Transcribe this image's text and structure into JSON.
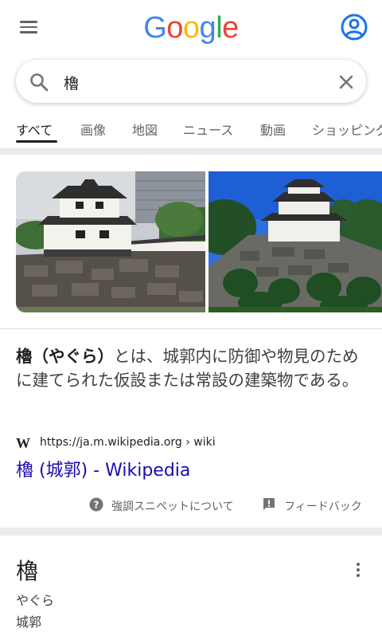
{
  "header": {
    "logo_letters": [
      {
        "ch": "G",
        "color": "#4285F4"
      },
      {
        "ch": "o",
        "color": "#EA4335"
      },
      {
        "ch": "o",
        "color": "#FBBC05"
      },
      {
        "ch": "g",
        "color": "#4285F4"
      },
      {
        "ch": "l",
        "color": "#34A853"
      },
      {
        "ch": "e",
        "color": "#EA4335"
      }
    ],
    "menu_icon": "hamburger-menu-icon",
    "account_icon": "account-circle-icon",
    "account_color": "#1a73e8"
  },
  "search": {
    "query": "櫓",
    "search_icon": "search-icon",
    "clear_icon": "close-icon"
  },
  "tabs": [
    {
      "label": "すべて",
      "active": true
    },
    {
      "label": "画像",
      "active": false
    },
    {
      "label": "地図",
      "active": false
    },
    {
      "label": "ニュース",
      "active": false
    },
    {
      "label": "動画",
      "active": false
    },
    {
      "label": "ショッピング",
      "active": false
    }
  ],
  "snippet": {
    "term": "櫓（やぐら）",
    "text": "とは、城郭内に防御や物見のために建てられた仮設または常設の建築物である。",
    "source_icon": "wikipedia-w-icon",
    "source_url": "https://ja.m.wikipedia.org › wiki",
    "link_title": "櫓 (城郭) - Wikipedia",
    "link_color": "#1a0dab"
  },
  "snippet_footer": {
    "about_icon": "help-circle-icon",
    "about_label": "強調スニペットについて",
    "feedback_icon": "feedback-icon",
    "feedback_label": "フィードバック"
  },
  "dictionary": {
    "word": "櫓",
    "reading": "やぐら",
    "meaning": "城郭",
    "more_icon": "more-vert-icon"
  }
}
